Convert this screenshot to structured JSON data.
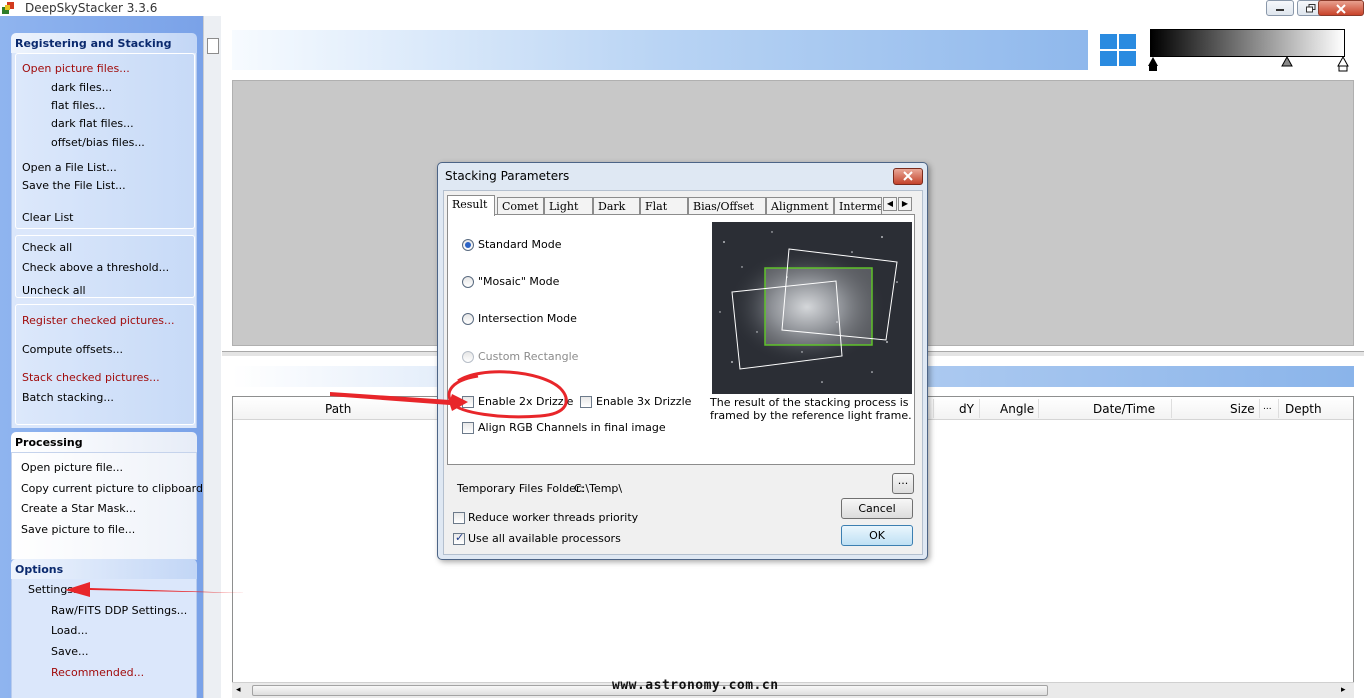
{
  "window": {
    "title": "DeepSkyStacker 3.3.6",
    "icon": "app-icon"
  },
  "sidebar": {
    "registering": {
      "header": "Registering and Stacking",
      "items": [
        {
          "label": "Open picture files...",
          "color": "red"
        },
        {
          "label": "dark files..."
        },
        {
          "label": "flat files..."
        },
        {
          "label": "dark flat files..."
        },
        {
          "label": "offset/bias files..."
        },
        {
          "label": "Open a File List..."
        },
        {
          "label": "Save the File List..."
        },
        {
          "label": "Clear List"
        },
        {
          "label": "Check all"
        },
        {
          "label": "Check above a threshold..."
        },
        {
          "label": "Uncheck all"
        },
        {
          "label": "Register checked pictures...",
          "color": "red"
        },
        {
          "label": "Compute offsets..."
        },
        {
          "label": "Stack checked pictures...",
          "color": "red"
        },
        {
          "label": "Batch stacking..."
        }
      ]
    },
    "processing": {
      "header": "Processing",
      "items": [
        {
          "label": "Open picture file..."
        },
        {
          "label": "Copy current picture to clipboard"
        },
        {
          "label": "Create a Star Mask..."
        },
        {
          "label": "Save picture to file..."
        }
      ]
    },
    "options": {
      "header": "Options",
      "items": [
        {
          "label": "Settings..."
        },
        {
          "label": "Raw/FITS DDP Settings..."
        },
        {
          "label": "Load..."
        },
        {
          "label": "Save..."
        },
        {
          "label": "Recommended...",
          "color": "red"
        }
      ]
    }
  },
  "filelist": {
    "columns": [
      "Path",
      "dY",
      "Angle",
      "Date/Time",
      "Size",
      "...",
      "Depth"
    ]
  },
  "watermark": "www.astronomy.com.cn",
  "dialog": {
    "title": "Stacking Parameters",
    "tabs": [
      "Result",
      "Comet",
      "Light",
      "Dark",
      "Flat",
      "Bias/Offset",
      "Alignment",
      "Intermediate"
    ],
    "active_tab": "Result",
    "modes": [
      {
        "label": "Standard Mode",
        "checked": true,
        "enabled": true
      },
      {
        "label": "\"Mosaic\" Mode",
        "checked": false,
        "enabled": true
      },
      {
        "label": "Intersection Mode",
        "checked": false,
        "enabled": true
      },
      {
        "label": "Custom Rectangle",
        "checked": false,
        "enabled": false
      }
    ],
    "drizzle2x": {
      "label": "Enable 2x Drizzle",
      "checked": false
    },
    "drizzle3x": {
      "label": "Enable 3x Drizzle",
      "checked": false
    },
    "align_rgb": {
      "label": "Align RGB Channels in final image",
      "checked": false
    },
    "caption": "The result of the stacking process is framed by the reference light frame.",
    "temp_folder_label": "Temporary Files Folder:",
    "temp_folder_value": "C:\\Temp\\",
    "browse_label": "...",
    "reduce_threads": {
      "label": "Reduce worker threads priority",
      "checked": false
    },
    "use_all_cpus": {
      "label": "Use all available processors",
      "checked": true
    },
    "cancel_label": "Cancel",
    "ok_label": "OK"
  },
  "colors": {
    "accent_red": "#a10c0c",
    "annotation_red": "#e8262a",
    "selection_green": "#5fc22a"
  }
}
